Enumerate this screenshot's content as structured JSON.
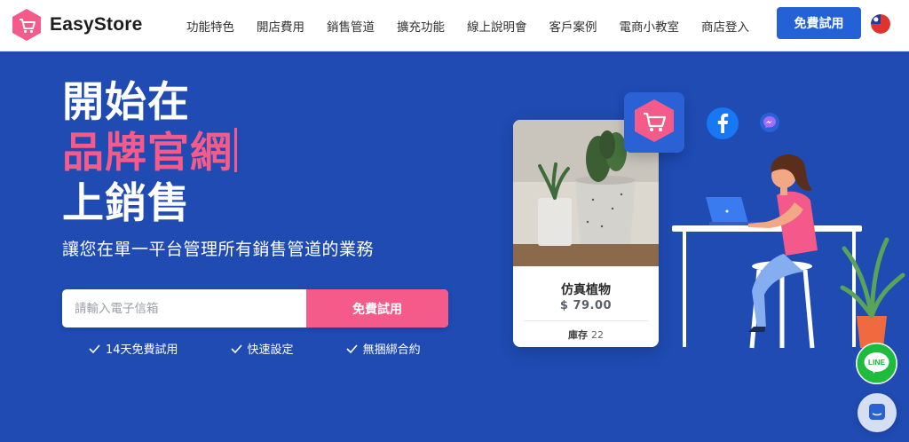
{
  "brand": {
    "name": "EasyStore"
  },
  "nav": {
    "items": [
      "功能特色",
      "開店費用",
      "銷售管道",
      "擴充功能",
      "線上說明會",
      "客戶案例",
      "電商小教室",
      "商店登入"
    ],
    "cta_label": "免費試用"
  },
  "hero": {
    "line1": "開始在",
    "line2": "品牌官網",
    "line3": "上銷售",
    "subtitle": "讓您在單一平台管理所有銷售管道的業務"
  },
  "signup": {
    "email_placeholder": "請輸入電子信箱",
    "button_label": "免費試用"
  },
  "features": [
    "14天免費試用",
    "快速設定",
    "無捆綁合約"
  ],
  "product_card": {
    "name": "仿真植物",
    "price": "$ 79.00",
    "stock_label": "庫存",
    "stock_value": "22"
  },
  "floating_buttons": {
    "line_label": "LINE"
  },
  "colors": {
    "hero_bg": "#1f4bb3",
    "accent_pink": "#f45a8a",
    "primary_blue": "#2461d6",
    "line_green": "#1fbb3c"
  },
  "icons": [
    "easystore-logo-icon",
    "taiwan-flag-icon",
    "check-icon",
    "store-cart-icon",
    "facebook-icon",
    "messenger-icon",
    "line-icon",
    "chat-icon"
  ]
}
